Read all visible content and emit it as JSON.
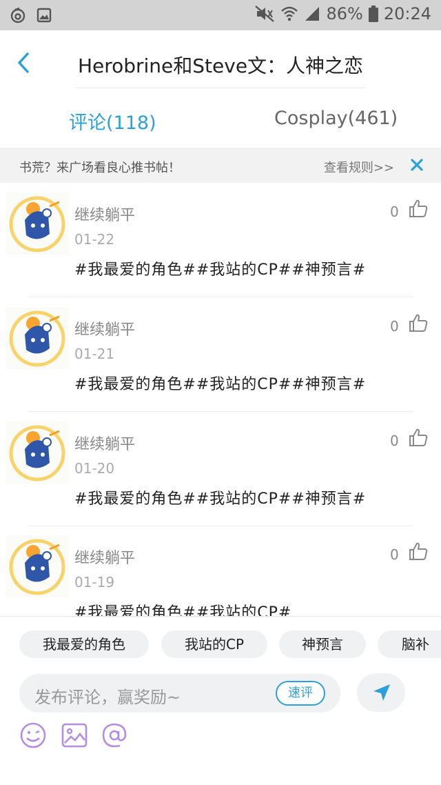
{
  "status_bar": {
    "battery": "86%",
    "time": "20:24",
    "icons": [
      "weibo-icon",
      "gallery-icon",
      "mute-icon",
      "wifi-icon",
      "signal-icon",
      "battery-icon"
    ]
  },
  "header": {
    "title": "Herobrine和Steve文：人神之恋",
    "back_icon": "chevron-left-icon"
  },
  "tabs": [
    {
      "label": "评论(118)",
      "active": true
    },
    {
      "label": "Cosplay(461)",
      "active": false
    }
  ],
  "notice": {
    "text": "书荒？来广场看良心推书帖！",
    "rules_link": "查看规则>>",
    "close_icon": "close-icon"
  },
  "comments": [
    {
      "author": "继续躺平",
      "date": "01-22",
      "text": "#我最爱的角色##我站的CP##神预言#",
      "likes": "0"
    },
    {
      "author": "继续躺平",
      "date": "01-21",
      "text": "#我最爱的角色##我站的CP##神预言#",
      "likes": "0"
    },
    {
      "author": "继续躺平",
      "date": "01-20",
      "text": "#我最爱的角色##我站的CP##神预言#",
      "likes": "0"
    },
    {
      "author": "继续躺平",
      "date": "01-19",
      "text": "#我最爱的角色##我站的CP#",
      "likes": "0"
    }
  ],
  "bottom": {
    "tags": [
      "我最爱的角色",
      "我站的CP",
      "神预言",
      "脑补"
    ],
    "input_placeholder": "发布评论，赢奖励~",
    "quick_comment_label": "速评",
    "send_icon": "send-icon",
    "tools": [
      "emoji-icon",
      "image-icon",
      "at-icon"
    ]
  },
  "colors": {
    "accent": "#2aa1dc",
    "tool_icon": "#b48be6",
    "status_bar_bg": "#d3d3d3"
  }
}
